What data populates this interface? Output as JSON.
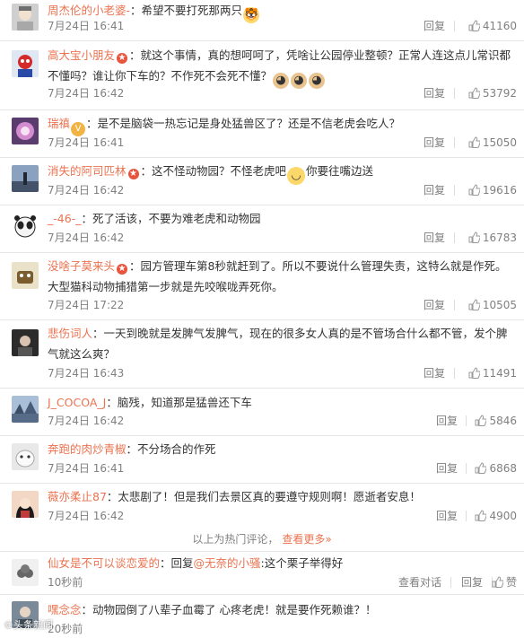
{
  "comments": [
    {
      "name": "周杰伦的小老婆-",
      "text": "：希望不要打死那两只",
      "time": "7月24日 16:41",
      "reply": "回复",
      "likes": "41160"
    },
    {
      "name": "高大宝小朋友",
      "text": "：就这个事情，真的想呵呵了，凭啥让公园停业整顿？正常人连这点儿常识都不懂吗？谁让你下车的？不作死不会死不懂？",
      "time": "7月24日 16:42",
      "reply": "回复",
      "likes": "53792"
    },
    {
      "name": "瑞禛",
      "text": "：是不是脑袋一热忘记是身处猛兽区了？还是不信老虎会吃人？",
      "time": "7月24日 16:41",
      "reply": "回复",
      "likes": "15050"
    },
    {
      "name": "消失的阿司匹林",
      "text": "：这不怪动物园？不怪老虎吧",
      "text2": "你要往嘴边送",
      "time": "7月24日 16:42",
      "reply": "回复",
      "likes": "19616"
    },
    {
      "name": "_-46-_",
      "text": "：死了活该，不要为难老虎和动物园",
      "time": "7月24日 16:42",
      "reply": "回复",
      "likes": "16783"
    },
    {
      "name": "没啥子莫来头",
      "text": "：园方管理车第8秒就赶到了。所以不要说什么管理失责，这特么就是作死。大型猫科动物捕猎第一步就是先咬喉咙弄死你。",
      "time": "7月24日 17:22",
      "reply": "回复",
      "likes": "10505"
    },
    {
      "name": "悲伤词人",
      "text": "：一天到晚就是发脾气发脾气，现在的很多女人真的是不管场合什么都不管，发个脾气就这么爽？",
      "time": "7月24日 16:43",
      "reply": "回复",
      "likes": "11491"
    },
    {
      "name": "J_COCOA_J",
      "text": "：脑残，知道那是猛兽还下车",
      "time": "7月24日 16:42",
      "reply": "回复",
      "likes": "5846"
    },
    {
      "name": "奔跑的肉炒青椒",
      "text": "：不分场合的作死",
      "time": "7月24日 16:41",
      "reply": "回复",
      "likes": "6868"
    },
    {
      "name": "薇亦柔止87",
      "text": "：太悲剧了！但是我们去景区真的要遵守规则啊！愿逝者安息！",
      "time": "7月24日 16:42",
      "reply": "回复",
      "likes": "4900"
    }
  ],
  "hot_bar": {
    "text": "以上为热门评论，",
    "more": "查看更多»"
  },
  "recent": [
    {
      "name": "仙女是不可以谈恋爱的",
      "text_a": "：回复",
      "mention": "@无奈的小骚",
      "text_b": ":这个栗子举得好",
      "time": "10秒前",
      "view": "查看对话",
      "reply": "回复",
      "likes": "赞"
    },
    {
      "name": "嘿念念",
      "text": "：动物园倒了八辈子血霉了 心疼老虎！就是要作死赖谁？！",
      "time": "20秒前"
    }
  ],
  "watermark": "©头条新闻",
  "colors": {
    "link": "#eb7350",
    "meta": "#808080",
    "divider": "#e6e6e6"
  }
}
